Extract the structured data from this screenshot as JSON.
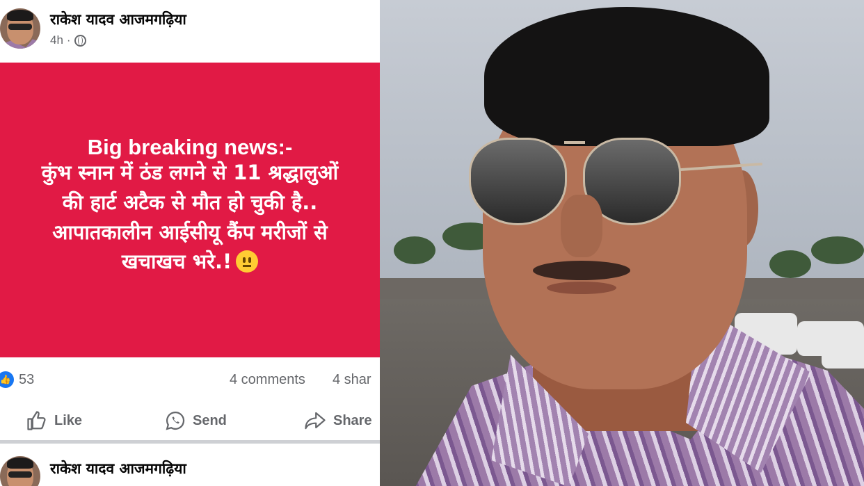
{
  "post": {
    "author": "राकेश यादव आजमगढ़िया",
    "time": "4h",
    "visibility_icon": "globe-icon",
    "card_color": "#e11a45",
    "headline": "Big breaking news:-",
    "lines": [
      "कुंभ स्नान में ठंड लगने से 11 श्रद्धालुओं",
      "की हार्ट अटैक से मौत हो चुकी है..",
      "आपातकालीन आईसीयू कैंप मरीजों से",
      "खचाखच भरे.!"
    ],
    "emoji": "neutral-face-emoji",
    "reactions_count": "53",
    "comments": "4 comments",
    "shares": "4 shar",
    "actions": {
      "like": "Like",
      "send": "Send",
      "share": "Share"
    }
  },
  "post2": {
    "author": "राकेश यादव आजमगढ़िया"
  },
  "photo": {
    "description_icon": "portrait-photo"
  }
}
